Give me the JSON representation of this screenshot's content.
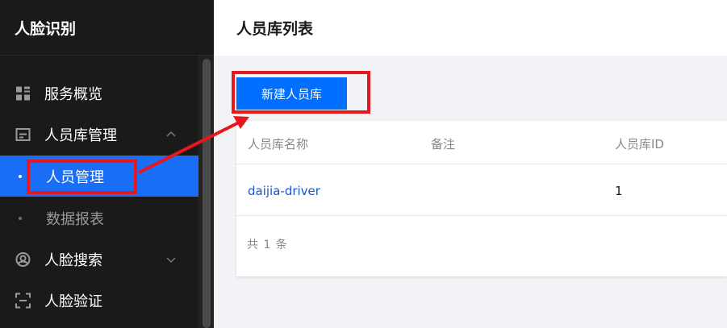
{
  "sidebar": {
    "title": "人脸识别",
    "items": [
      {
        "label": "服务概览",
        "icon": "grid-icon"
      },
      {
        "label": "人员库管理",
        "icon": "id-card-icon",
        "chevron": "chevron-up-icon"
      },
      {
        "label": "人员管理",
        "active": true
      },
      {
        "label": "数据报表"
      },
      {
        "label": "人脸搜索",
        "icon": "face-search-icon",
        "chevron": "chevron-down-icon"
      },
      {
        "label": "人脸验证",
        "icon": "scan-icon"
      }
    ]
  },
  "header": {
    "title": "人员库列表"
  },
  "toolbar": {
    "create_label": "新建人员库"
  },
  "table": {
    "columns": [
      "人员库名称",
      "备注",
      "人员库ID"
    ],
    "rows": [
      {
        "name": "daijia-driver",
        "note": "",
        "id": "1"
      }
    ],
    "footer": "共 1 条"
  },
  "colors": {
    "sidebar_bg": "#1a1a1a",
    "accent": "#006eff",
    "active_nav": "#1a6ef5",
    "annotation": "#e8161d",
    "link": "#1a56c9"
  }
}
